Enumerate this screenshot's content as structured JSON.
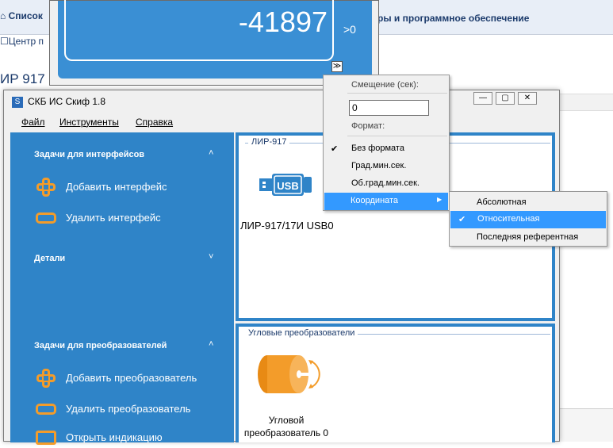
{
  "background_browser": {
    "tab_list": "Список",
    "tab_hardware": "ры и программное обеспечение",
    "tab_center": "Центр п",
    "heading": "ИР 917"
  },
  "indicator": {
    "value": "-41897",
    "flag": ">0",
    "toggle_icon": "chevron-double-down-icon"
  },
  "app": {
    "title": "СКБ ИС Скиф 1.8",
    "menu": [
      "Файл",
      "Инструменты",
      "Справка"
    ],
    "sidebar": {
      "interfaces_header": "Задачи для интерфейсов",
      "add_interface": "Добавить интерфейс",
      "remove_interface": "Удалить интерфейс",
      "details_header": "Детали",
      "converters_header": "Задачи для преобразователей",
      "add_converter": "Добавить преобразователь",
      "remove_converter": "Удалить преобразователь",
      "open_indication": "Открыть индикацию"
    },
    "device_group": {
      "title": "ЛИР-917",
      "device_label": "ЛИР-917/17И USB0",
      "usb_text": "USB"
    },
    "encoder_group": {
      "title": "Угловые преобразователи",
      "encoder_label_line1": "Угловой",
      "encoder_label_line2": "преобразователь 0"
    }
  },
  "context_menu": {
    "offset_label": "Смещение (сек):",
    "offset_value": "0",
    "format_label": "Формат:",
    "formats": [
      "Без формата",
      "Град.мин.сек.",
      "Об.град.мин.сек."
    ],
    "selected_format": "Без формата",
    "coordinate_label": "Координата"
  },
  "submenu": {
    "items": [
      "Абсолютная",
      "Относительная",
      "Последняя референтная"
    ],
    "selected": "Относительная"
  },
  "colors": {
    "accent_blue": "#2f84c8",
    "highlight": "#3399ff",
    "icon_orange": "#f39c2a"
  }
}
